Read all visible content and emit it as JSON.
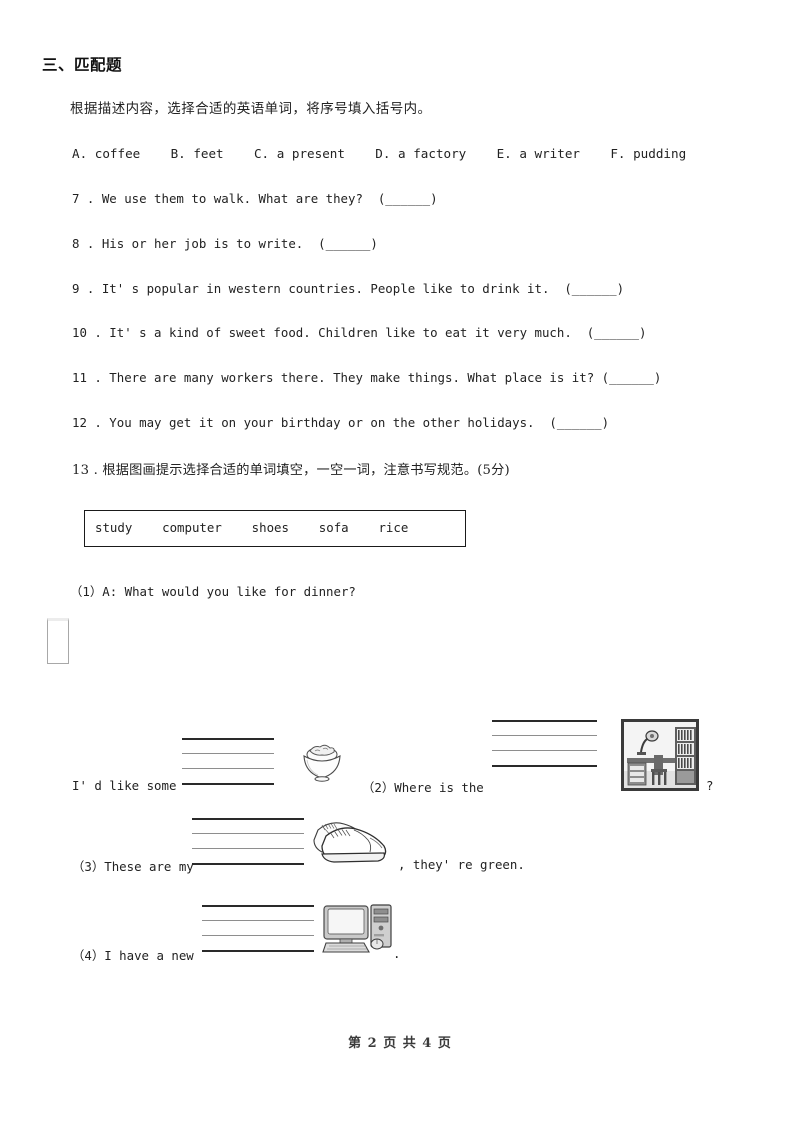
{
  "section": {
    "title": "三、匹配题",
    "instruction": "根据描述内容，选择合适的英语单词，将序号填入括号内。"
  },
  "options_line": "A. coffee    B. feet    C. a present    D. a factory    E. a writer    F. pudding",
  "options": [
    {
      "letter": "A.",
      "word": "coffee"
    },
    {
      "letter": "B.",
      "word": "feet"
    },
    {
      "letter": "C.",
      "word": "a present"
    },
    {
      "letter": "D.",
      "word": "a factory"
    },
    {
      "letter": "E.",
      "word": "a writer"
    },
    {
      "letter": "F.",
      "word": "pudding"
    }
  ],
  "questions": [
    {
      "number": "7",
      "text": "7 . We use them to walk. What are they?  (______)"
    },
    {
      "number": "8",
      "text": "8 . His or her job is to write.  (______)"
    },
    {
      "number": "9",
      "text": "9 . It' s popular in western countries. People like to drink it.  (______)"
    },
    {
      "number": "10",
      "text": "10 . It' s a kind of sweet food. Children like to eat it very much.  (______)"
    },
    {
      "number": "11",
      "text": "11 . There are many workers there. They make things. What place is it? (______)"
    },
    {
      "number": "12",
      "text": "12 . You may get it on your birthday or on the other holidays.  (______)"
    },
    {
      "number": "13",
      "text": "13 . 根据图画提示选择合适的单词填空，一空一词，注意书写规范。(5分)"
    }
  ],
  "word_bank": {
    "text": "study    computer    shoes    sofa    rice",
    "words": [
      "study",
      "computer",
      "shoes",
      "sofa",
      "rice"
    ]
  },
  "fill_items": {
    "q1_prompt": "（1）A: What would you like for dinner?",
    "q1_answer_prefix": "I' d like some",
    "q1_answer_suffix": ".",
    "q1_picture": "rice-bowl-image",
    "q2_prefix": "（2）Where is the",
    "q2_suffix": "?",
    "q2_picture": "study-room-image",
    "q3_prefix": "（3）These are my",
    "q3_suffix": ", they' re green.",
    "q3_picture": "shoes-image",
    "q4_prefix": "（4）I have a new",
    "q4_suffix": ".",
    "q4_picture": "computer-image"
  },
  "footer": {
    "text": "第 2 页 共 4 页"
  }
}
